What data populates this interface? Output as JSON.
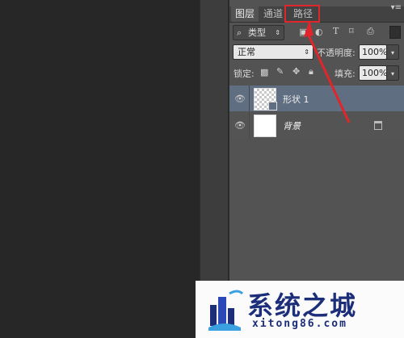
{
  "layers_panel": {
    "tabs": [
      {
        "label": "图层"
      },
      {
        "label": "通道"
      },
      {
        "label": "路径"
      }
    ],
    "menu_icon": "panel-menu-icon",
    "filter": {
      "kind_label": "类型",
      "icons": [
        "image-filter-icon",
        "adjustment-filter-icon",
        "type-filter-icon",
        "shape-filter-icon",
        "smart-object-filter-icon"
      ]
    },
    "blend_mode": "正常",
    "opacity_label": "不透明度:",
    "opacity_value": "100%",
    "lock_label": "锁定:",
    "fill_label": "填充:",
    "fill_value": "100%",
    "layers": [
      {
        "name": "形状 1",
        "selected": true,
        "thumbnail": "transparent-checkerboard"
      },
      {
        "name": "背景",
        "selected": false,
        "thumbnail": "white",
        "locked": true
      }
    ]
  },
  "annotation": {
    "highlight_color": "#e0262a",
    "target": "路径"
  },
  "watermark": {
    "title": "系统之城",
    "url": "xitong86.com",
    "color": "#1c2e7a"
  }
}
